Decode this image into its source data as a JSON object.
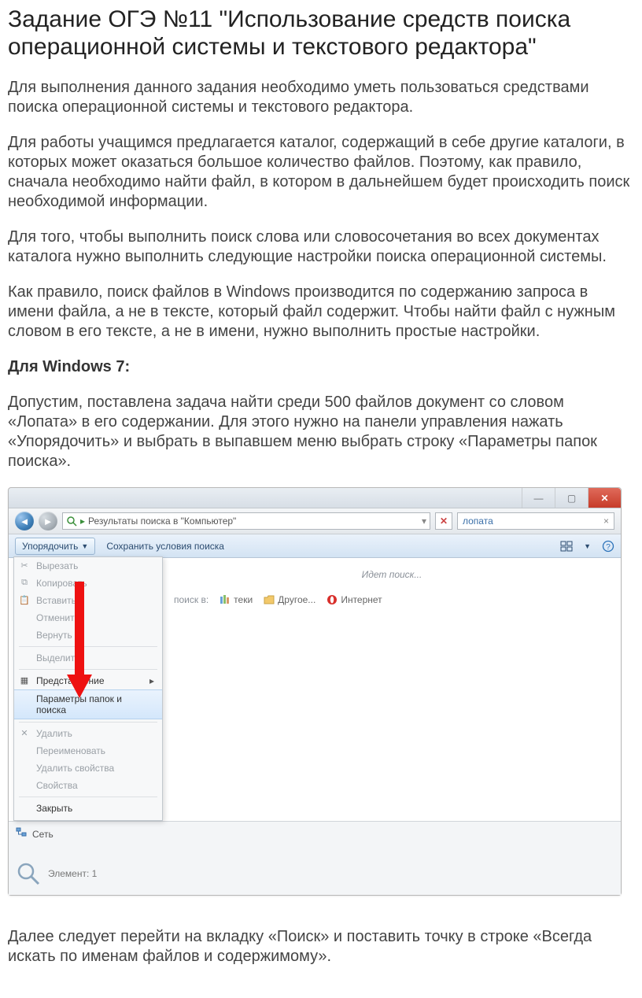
{
  "title": "Задание ОГЭ №11 \"Использование средств поиска операционной системы и текстового редактора\"",
  "p1": "Для выполнения данного задания необходимо уметь пользоваться средствами поиска операционной системы и текстового редактора.",
  "p2": "Для работы учащимся предлагается каталог, содержащий в себе другие каталоги, в которых может оказаться большое количество файлов. Поэтому, как правило, сначала необходимо найти файл, в котором в дальнейшем будет происходить поиск необходимой информации.",
  "p3": "Для того, чтобы выполнить поиск слова или словосочетания во всех документах каталога нужно выполнить следующие настройки поиска операционной системы.",
  "p4": "Как правило, поиск файлов в Windows производится по содержанию запроса в имени файла, а не в тексте, который файл содержит. Чтобы найти файл с нужным словом в его тексте, а не в имени, нужно выполнить простые настройки.",
  "h_win7": "Для Windows 7:",
  "p5": "Допустим, поставлена задача найти среди 500 файлов документ со словом «Лопата» в его содержании. Для этого нужно на панели управления нажать «Упорядочить» и выбрать в выпавшем меню выбрать строку «Параметры папок  поиска».",
  "p6": "Далее следует перейти на вкладку «Поиск» и поставить точку в строке «Всегда искать по именам файлов и содержимому».",
  "explorer": {
    "breadcrumb": "Результаты поиска в \"Компьютер\"",
    "search_value": "лопата",
    "toolbar": {
      "organize": "Упорядочить",
      "save_search": "Сохранить условия поиска"
    },
    "menu": {
      "cut": "Вырезать",
      "copy": "Копировать",
      "paste": "Вставить",
      "undo": "Отменить",
      "redo": "Вернуть",
      "selectall": "Выделить",
      "layout": "Представление",
      "folder_options": "Параметры папок и поиска",
      "delete": "Удалить",
      "rename": "Переименовать",
      "remove_props": "Удалить свойства",
      "properties": "Свойства",
      "close": "Закрыть"
    },
    "main": {
      "searching": "Идет поиск...",
      "also_label": "поиск в:",
      "libraries": "теки",
      "other": "Другое...",
      "internet": "Интернет"
    },
    "footer": {
      "network": "Сеть",
      "element": "Элемент: 1"
    }
  }
}
